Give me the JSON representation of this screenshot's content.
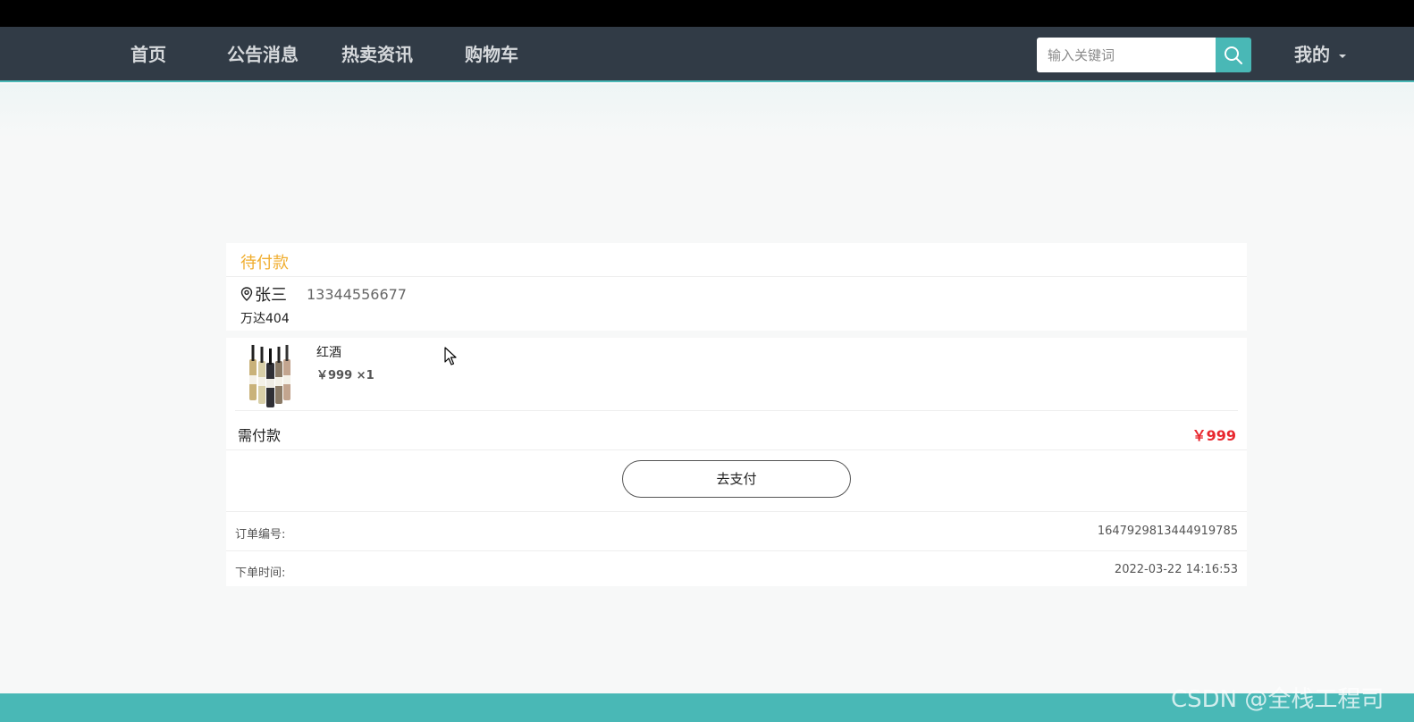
{
  "nav": {
    "items": [
      "首页",
      "公告消息",
      "热卖资讯",
      "购物车"
    ],
    "search_placeholder": "输入关键词",
    "my_label": "我的"
  },
  "order": {
    "status": "待付款",
    "recipient_name": "张三",
    "phone": "13344556677",
    "address": "万达404",
    "product_name": "红酒",
    "product_price": "￥999",
    "product_qty": "×1",
    "need_pay_label": "需付款",
    "need_pay_value": "￥999",
    "pay_button": "去支付",
    "order_no_label": "订单编号:",
    "order_no_value": "1647929813444919785",
    "order_time_label": "下单时间:",
    "order_time_value": "2022-03-22 14:16:53"
  },
  "watermark": "CSDN @全栈工程司",
  "colors": {
    "navbar": "#313b46",
    "accent": "#49b8b6",
    "status": "#f0ad2e",
    "price": "#e8272e"
  }
}
